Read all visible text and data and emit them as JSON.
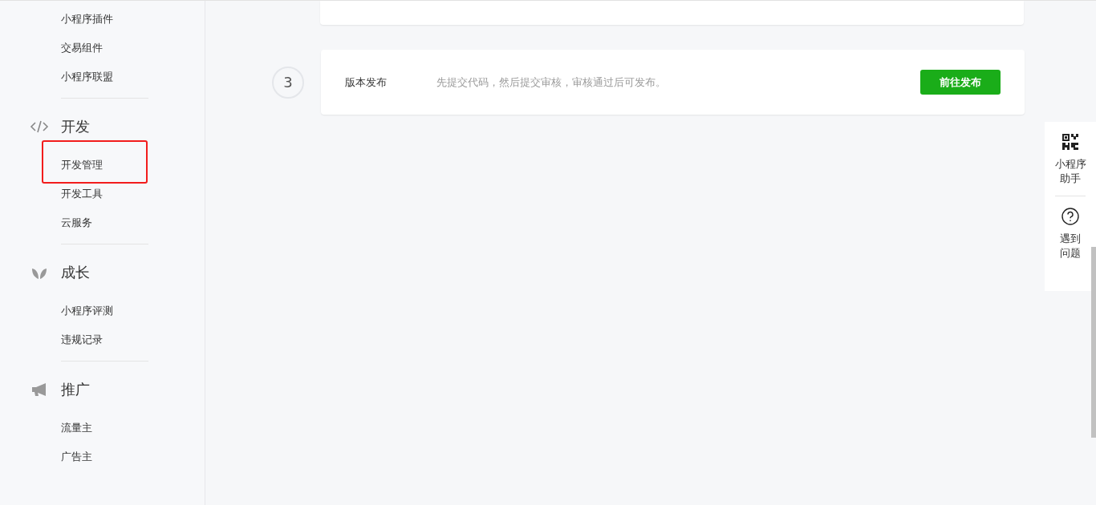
{
  "sidebar": {
    "sections": [
      {
        "items": [
          {
            "label": "小程序插件",
            "highlighted": false
          },
          {
            "label": "交易组件",
            "highlighted": false
          },
          {
            "label": "小程序联盟",
            "highlighted": false
          }
        ]
      },
      {
        "title": "开发",
        "items": [
          {
            "label": "开发管理",
            "highlighted": true
          },
          {
            "label": "开发工具",
            "highlighted": false
          },
          {
            "label": "云服务",
            "highlighted": false
          }
        ]
      },
      {
        "title": "成长",
        "items": [
          {
            "label": "小程序评测",
            "highlighted": false
          },
          {
            "label": "违规记录",
            "highlighted": false
          }
        ]
      },
      {
        "title": "推广",
        "items": [
          {
            "label": "流量主",
            "highlighted": false
          },
          {
            "label": "广告主",
            "highlighted": false
          }
        ]
      }
    ]
  },
  "steps": [
    {
      "number": "3",
      "title": "版本发布",
      "description": "先提交代码，然后提交审核，审核通过后可发布。",
      "button": "前往发布"
    }
  ],
  "float_panel": [
    {
      "label_lines": [
        "小程序",
        "助手"
      ]
    },
    {
      "label_lines": [
        "遇到",
        "问题"
      ]
    }
  ]
}
